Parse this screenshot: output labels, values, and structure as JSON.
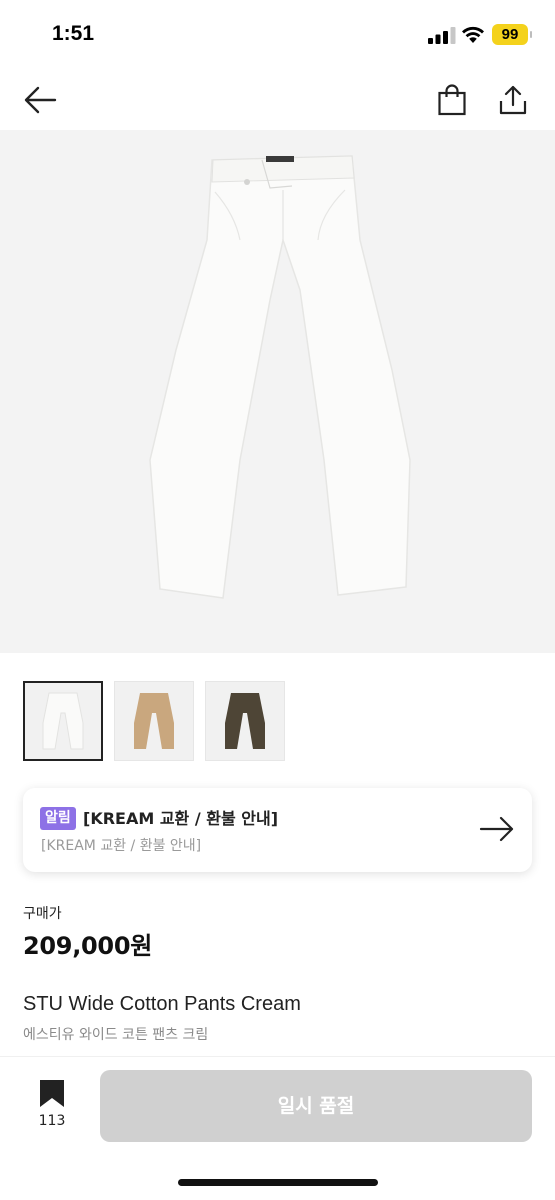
{
  "status_bar": {
    "time": "1:51",
    "battery": "99",
    "icons": [
      "signal-icon",
      "wifi-icon",
      "battery-icon"
    ]
  },
  "nav": {
    "back_icon": "back-arrow-icon",
    "bag_icon": "shopping-bag-icon",
    "share_icon": "share-icon"
  },
  "product": {
    "image_icon": "wide-pants-cream",
    "thumbnails": [
      {
        "name": "cream",
        "color": "#f6f6f4",
        "selected": true
      },
      {
        "name": "beige",
        "color": "#c9a77e",
        "selected": false
      },
      {
        "name": "brown",
        "color": "#4e4536",
        "selected": false
      }
    ]
  },
  "notice": {
    "badge": "알림",
    "title": "[KREAM 교환 / 환불 안내]",
    "subtitle": "[KREAM 교환 / 환불 안내]",
    "badge_color": "#8d71e6"
  },
  "price": {
    "label": "구매가",
    "value": "209,000원"
  },
  "name": {
    "english": "STU Wide Cotton Pants Cream",
    "korean": "에스티유 와이드 코튼 팬츠 크림"
  },
  "bottom": {
    "bookmark_count": "113",
    "button_label": "일시 품절"
  }
}
